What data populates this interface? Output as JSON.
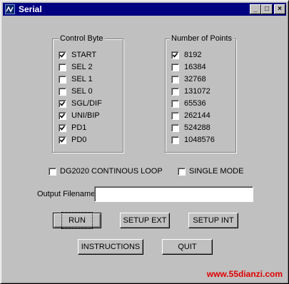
{
  "window": {
    "title": "Serial",
    "icon": "serial-app-icon",
    "controls": {
      "minimize": "_",
      "maximize": "□",
      "close": "×"
    }
  },
  "control_byte": {
    "title": "Control Byte",
    "items": [
      {
        "label": "START",
        "checked": true
      },
      {
        "label": "SEL 2",
        "checked": false
      },
      {
        "label": "SEL 1",
        "checked": false
      },
      {
        "label": "SEL 0",
        "checked": false
      },
      {
        "label": "SGL/DIF",
        "checked": true
      },
      {
        "label": "UNI/BIP",
        "checked": true
      },
      {
        "label": "PD1",
        "checked": true
      },
      {
        "label": "PD0",
        "checked": true
      }
    ]
  },
  "number_of_points": {
    "title": "Number of Points",
    "items": [
      {
        "label": "8192",
        "checked": true
      },
      {
        "label": "16384",
        "checked": false
      },
      {
        "label": "32768",
        "checked": false
      },
      {
        "label": "131072",
        "checked": false
      },
      {
        "label": "65536",
        "checked": false
      },
      {
        "label": "262144",
        "checked": false
      },
      {
        "label": "524288",
        "checked": false
      },
      {
        "label": "1048576",
        "checked": false
      }
    ]
  },
  "options": {
    "continuous_loop": {
      "label": "DG2020 CONTINOUS LOOP",
      "checked": false
    },
    "single_mode": {
      "label": "SINGLE MODE",
      "checked": false
    }
  },
  "output": {
    "label": "Output Filename",
    "value": ""
  },
  "buttons": {
    "run": "RUN",
    "setup_ext": "SETUP EXT",
    "setup_int": "SETUP INT",
    "instructions": "INSTRUCTIONS",
    "quit": "QUIT"
  },
  "watermark": "www.55dianzi.com"
}
